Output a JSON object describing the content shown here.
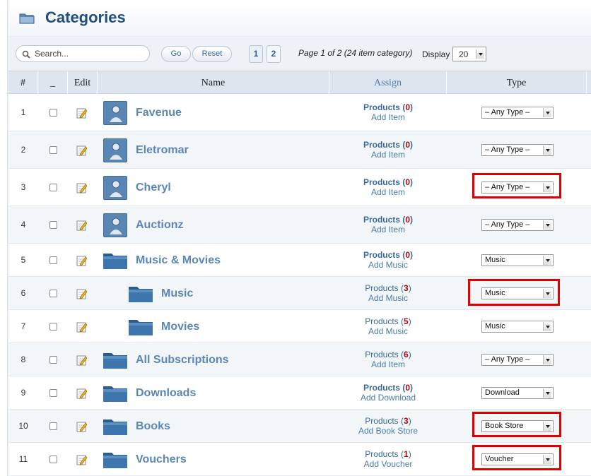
{
  "page": {
    "title": "Categories"
  },
  "toolbar": {
    "search_placeholder": "Search...",
    "go_label": "Go",
    "reset_label": "Reset",
    "pages": [
      "1",
      "2"
    ],
    "page_info": "Page 1 of 2 (24 item category)",
    "display_label": "Display",
    "display_value": "20"
  },
  "table": {
    "headers": {
      "num": "#",
      "check": "_",
      "edit": "Edit",
      "name": "Name",
      "assign": "Assign",
      "type": "Type"
    },
    "rows": [
      {
        "num": "1",
        "name": "Favenue",
        "kind": "user",
        "indent": 0,
        "products_label": "Products",
        "count": "0",
        "add_label": "Add Item",
        "type": "– Any Type –",
        "bold": true,
        "highlight": false
      },
      {
        "num": "2",
        "name": "Eletromar",
        "kind": "user",
        "indent": 0,
        "products_label": "Products",
        "count": "0",
        "add_label": "Add Item",
        "type": "– Any Type –",
        "bold": true,
        "highlight": false
      },
      {
        "num": "3",
        "name": "Cheryl",
        "kind": "user",
        "indent": 0,
        "products_label": "Products",
        "count": "0",
        "add_label": "Add Item",
        "type": "– Any Type –",
        "bold": true,
        "highlight": true
      },
      {
        "num": "4",
        "name": "Auctionz",
        "kind": "user",
        "indent": 0,
        "products_label": "Products",
        "count": "0",
        "add_label": "Add Item",
        "type": "– Any Type –",
        "bold": true,
        "highlight": false
      },
      {
        "num": "5",
        "name": "Music & Movies",
        "kind": "folder",
        "indent": 0,
        "products_label": "Products",
        "count": "0",
        "add_label": "Add Music",
        "type": "Music",
        "bold": true,
        "highlight": false
      },
      {
        "num": "6",
        "name": "Music",
        "kind": "folder",
        "indent": 1,
        "products_label": "Products",
        "count": "3",
        "add_label": "Add Music",
        "type": "Music",
        "bold": false,
        "highlight": true
      },
      {
        "num": "7",
        "name": "Movies",
        "kind": "folder",
        "indent": 1,
        "products_label": "Products",
        "count": "5",
        "add_label": "Add Music",
        "type": "Music",
        "bold": false,
        "highlight": false
      },
      {
        "num": "8",
        "name": "All Subscriptions",
        "kind": "folder",
        "indent": 0,
        "products_label": "Products",
        "count": "6",
        "add_label": "Add Item",
        "type": "– Any Type –",
        "bold": false,
        "highlight": false
      },
      {
        "num": "9",
        "name": "Downloads",
        "kind": "folder",
        "indent": 0,
        "products_label": "Products",
        "count": "0",
        "add_label": "Add Download",
        "type": "Download",
        "bold": true,
        "highlight": false
      },
      {
        "num": "10",
        "name": "Books",
        "kind": "folder",
        "indent": 0,
        "products_label": "Products",
        "count": "3",
        "add_label": "Add Book Store",
        "type": "Book Store",
        "bold": false,
        "highlight": true
      },
      {
        "num": "11",
        "name": "Vouchers",
        "kind": "folder",
        "indent": 0,
        "products_label": "Products",
        "count": "1",
        "add_label": "Add Voucher",
        "type": "Voucher",
        "bold": false,
        "highlight": true
      }
    ]
  }
}
